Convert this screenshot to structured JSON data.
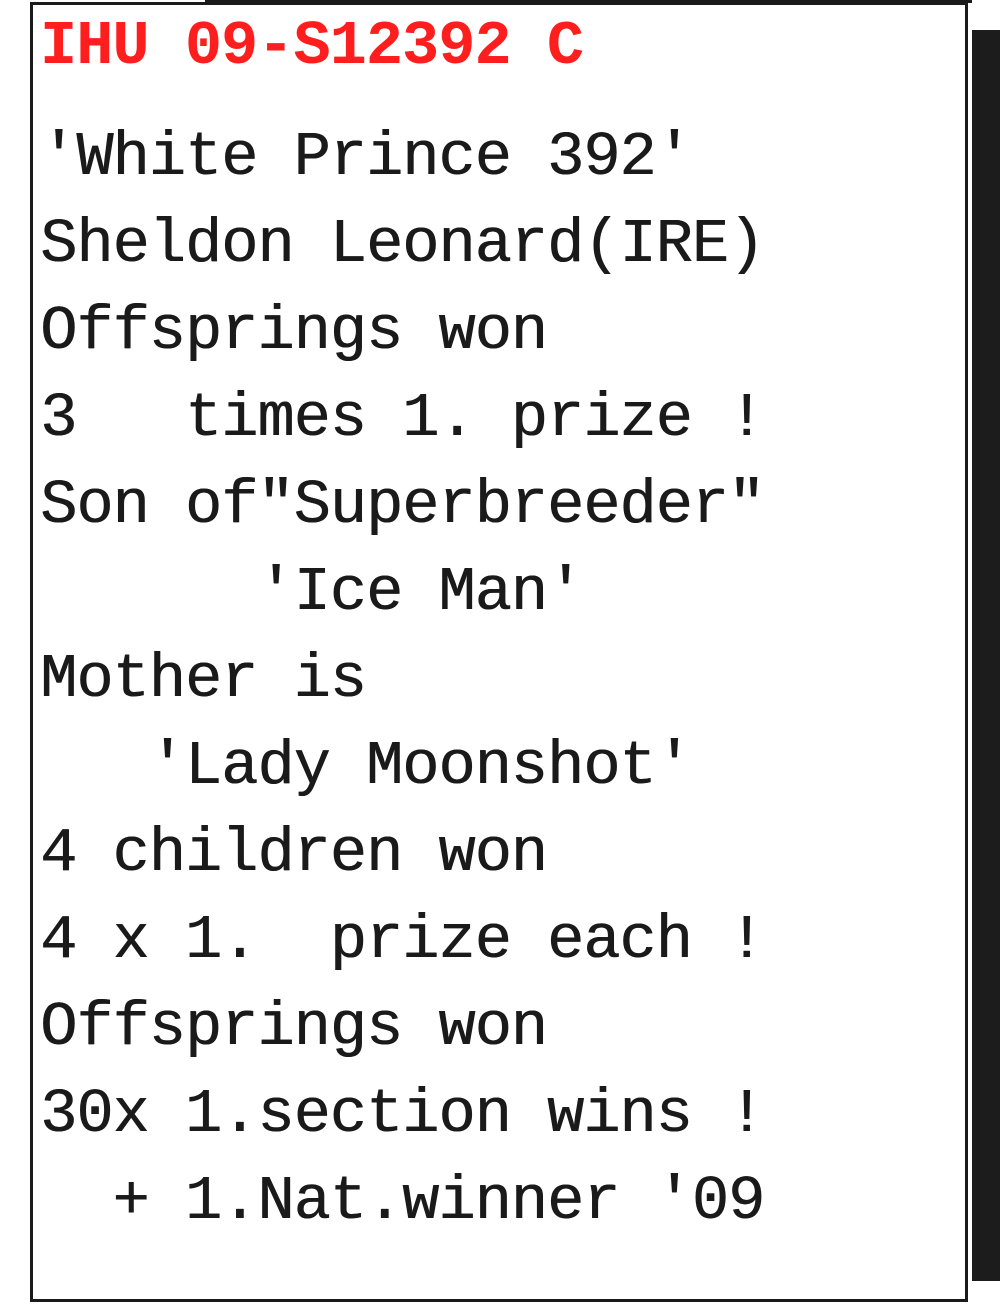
{
  "card": {
    "header": "IHU 09-S12392 C",
    "lines": [
      "'White Prince 392'",
      "Sheldon Leonard(IRE)",
      "Offsprings won",
      "3   times 1. prize !",
      "Son of\"Superbreeder\"",
      "      'Ice Man'",
      "Mother is",
      "   'Lady Moonshot'",
      "4 children won",
      "4 x 1.  prize each !",
      "Offsprings won",
      "30x 1.section wins !",
      "  + 1.Nat.winner '09"
    ]
  },
  "colors": {
    "header": "#ff1e1e",
    "text": "#1a1a1a",
    "background": "#ffffff"
  }
}
